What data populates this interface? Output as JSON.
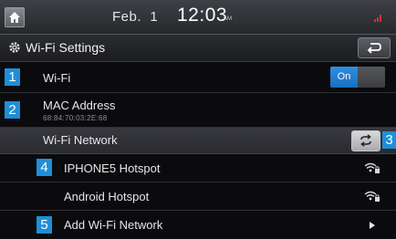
{
  "status_bar": {
    "date": "Feb.  1",
    "time": "12:03",
    "ampm": "AM"
  },
  "header": {
    "title": "Wi-Fi Settings"
  },
  "wifi_row": {
    "number": "1",
    "label": "Wi-Fi",
    "toggle_label": "On"
  },
  "mac_row": {
    "number": "2",
    "label": "MAC Address",
    "value": "68:84:70:03:2E:68"
  },
  "network_section": {
    "label": "Wi-Fi Network",
    "number": "3"
  },
  "networks": [
    {
      "number": "4",
      "name": "IPHONE5 Hotspot",
      "icon": "wifi-secured-icon"
    },
    {
      "number": "",
      "name": "Android Hotspot",
      "icon": "wifi-secured-icon"
    }
  ],
  "add_row": {
    "number": "5",
    "label": "Add Wi-Fi Network"
  },
  "colors": {
    "accent": "#1e8fd8",
    "background": "#0b0b0d"
  }
}
